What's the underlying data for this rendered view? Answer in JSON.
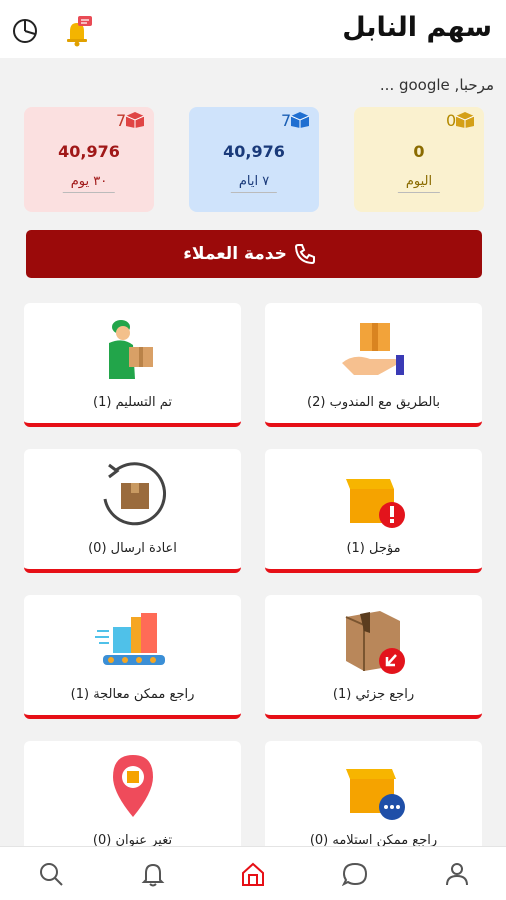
{
  "header": {
    "title": "سهم النابل",
    "icons": [
      "pie-chart-icon",
      "notification-bell-icon"
    ]
  },
  "welcome": "مرحبا, google ...",
  "stats": [
    {
      "count": "0",
      "value": "0",
      "period": "اليوم",
      "bg": "#faf1cf",
      "color": "#8a6b00",
      "icon": "gold-box-icon"
    },
    {
      "count": "7",
      "value": "40,976",
      "period": "٧ ايام",
      "bg": "#cfe3fb",
      "color": "#1a3a7a",
      "icon": "blue-box-icon"
    },
    {
      "count": "7",
      "value": "40,976",
      "period": "٣٠ يوم",
      "bg": "#fbe0e0",
      "color": "#a01818",
      "icon": "red-box-icon"
    }
  ],
  "customer_service": "خدمة العملاء",
  "cards": [
    {
      "label": "بالطريق مع المندوب (2)",
      "icon": "box-on-hand-icon"
    },
    {
      "label": "تم التسليم (1)",
      "icon": "delivery-man-icon"
    },
    {
      "label": "مؤجل (1)",
      "icon": "box-alert-icon"
    },
    {
      "label": "اعادة ارسال (0)",
      "icon": "box-return-icon"
    },
    {
      "label": "راجع جزئي (1)",
      "icon": "box-partial-return-icon"
    },
    {
      "label": "راجع ممكن معالجة (1)",
      "icon": "conveyor-boxes-icon"
    },
    {
      "label": "راجع ممكن استلامه (0)",
      "icon": "box-pending-icon"
    },
    {
      "label": "تغير عنوان (0)",
      "icon": "location-pin-icon"
    }
  ],
  "bottom_nav": [
    "search-icon",
    "bell-icon",
    "home-icon",
    "chat-icon",
    "profile-icon"
  ],
  "colors": {
    "accent": "#9b0a0a",
    "card_bar": "#e60f16"
  }
}
